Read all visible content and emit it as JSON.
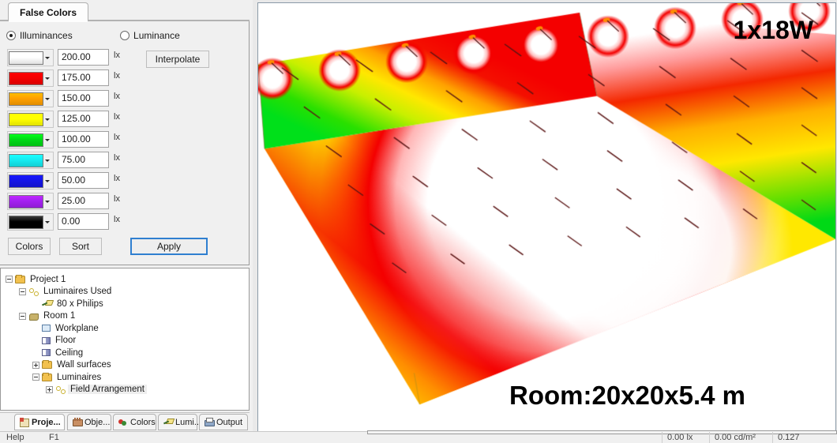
{
  "window": {
    "top_tab": {
      "label": "False Colors",
      "icon": "tab-icon"
    }
  },
  "false_colors_panel": {
    "mode": {
      "selected": "Illuminances",
      "options": [
        {
          "label": "Illuminances",
          "checked": true
        },
        {
          "label": "Luminance",
          "checked": false
        }
      ]
    },
    "unit": "lx",
    "interpolate_label": "Interpolate",
    "rows": [
      {
        "color": "#ffffff",
        "value": "200.00",
        "unit": "lx"
      },
      {
        "color": "#f40000",
        "value": "175.00",
        "unit": "lx"
      },
      {
        "color": "#ffa000",
        "value": "150.00",
        "unit": "lx"
      },
      {
        "color": "#ffff00",
        "value": "125.00",
        "unit": "lx"
      },
      {
        "color": "#00d916",
        "value": "100.00",
        "unit": "lx"
      },
      {
        "color": "#16eaf0",
        "value": "75.00",
        "unit": "lx"
      },
      {
        "color": "#1414e6",
        "value": "50.00",
        "unit": "lx"
      },
      {
        "color": "#a321f0",
        "value": "25.00",
        "unit": "lx"
      },
      {
        "color": "#000000",
        "value": "0.00",
        "unit": "lx"
      }
    ],
    "buttons": {
      "colors": "Colors",
      "sort": "Sort",
      "apply": "Apply"
    },
    "focus_color": "#2f7fd0"
  },
  "tree": {
    "nodes": [
      {
        "label": "Project 1",
        "depth": 0,
        "expander": "minus",
        "icon": "folder-icon",
        "selected": false
      },
      {
        "label": "Luminaires Used",
        "depth": 1,
        "expander": "minus",
        "icon": "network-icon",
        "selected": false
      },
      {
        "label": "80 x Philips",
        "depth": 2,
        "expander": "none",
        "icon": "luminaire-icon",
        "selected": false
      },
      {
        "label": "Room 1",
        "depth": 1,
        "expander": "minus",
        "icon": "room-icon",
        "selected": false
      },
      {
        "label": "Workplane",
        "depth": 2,
        "expander": "none",
        "icon": "workplane-icon",
        "selected": false
      },
      {
        "label": "Floor",
        "depth": 2,
        "expander": "none",
        "icon": "surface-icon",
        "selected": false
      },
      {
        "label": "Ceiling",
        "depth": 2,
        "expander": "none",
        "icon": "surface-icon",
        "selected": false
      },
      {
        "label": "Wall surfaces",
        "depth": 2,
        "expander": "plus",
        "icon": "folder-icon",
        "selected": false
      },
      {
        "label": "Luminaires",
        "depth": 2,
        "expander": "minus",
        "icon": "folder-icon",
        "selected": false
      },
      {
        "label": "Field Arrangement",
        "depth": 3,
        "expander": "plus",
        "icon": "network-icon",
        "selected": true
      }
    ]
  },
  "bottom_tabs": [
    {
      "label": "Proje...",
      "icon": "project-icon",
      "active": true
    },
    {
      "label": "Obje...",
      "icon": "object-icon",
      "active": false
    },
    {
      "label": "Colors",
      "icon": "colors-icon",
      "active": false
    },
    {
      "label": "Lumi...",
      "icon": "luminaire-icon",
      "active": false
    },
    {
      "label": "Output",
      "icon": "printer-icon",
      "active": false
    }
  ],
  "view": {
    "wattage_label": "1x18W",
    "room_label": "Room:20x20x5.4 m"
  },
  "statusbar": {
    "help": "Help",
    "shortcut": "F1",
    "illuminance": "0.00 lx",
    "luminance": "0.00  cd/m²",
    "ratio": "0.127"
  },
  "scene_data": {
    "type": "false-color-3d-render",
    "room_dimensions": {
      "length_m": 20,
      "width_m": 20,
      "height_m": 5.4
    },
    "luminaire_count": 80,
    "luminaire_type": "Philips",
    "luminaire_wattage": "1x18W",
    "scale_min_lx": 0,
    "scale_max_lx": 200,
    "scale_step_lx": 25,
    "scale_colors": [
      "#000000",
      "#a321f0",
      "#1414e6",
      "#16eaf0",
      "#00d916",
      "#ffff00",
      "#ffa000",
      "#f40000",
      "#ffffff"
    ],
    "surfaces": [
      "floor",
      "back-wall",
      "right-wall",
      "ceiling"
    ]
  }
}
